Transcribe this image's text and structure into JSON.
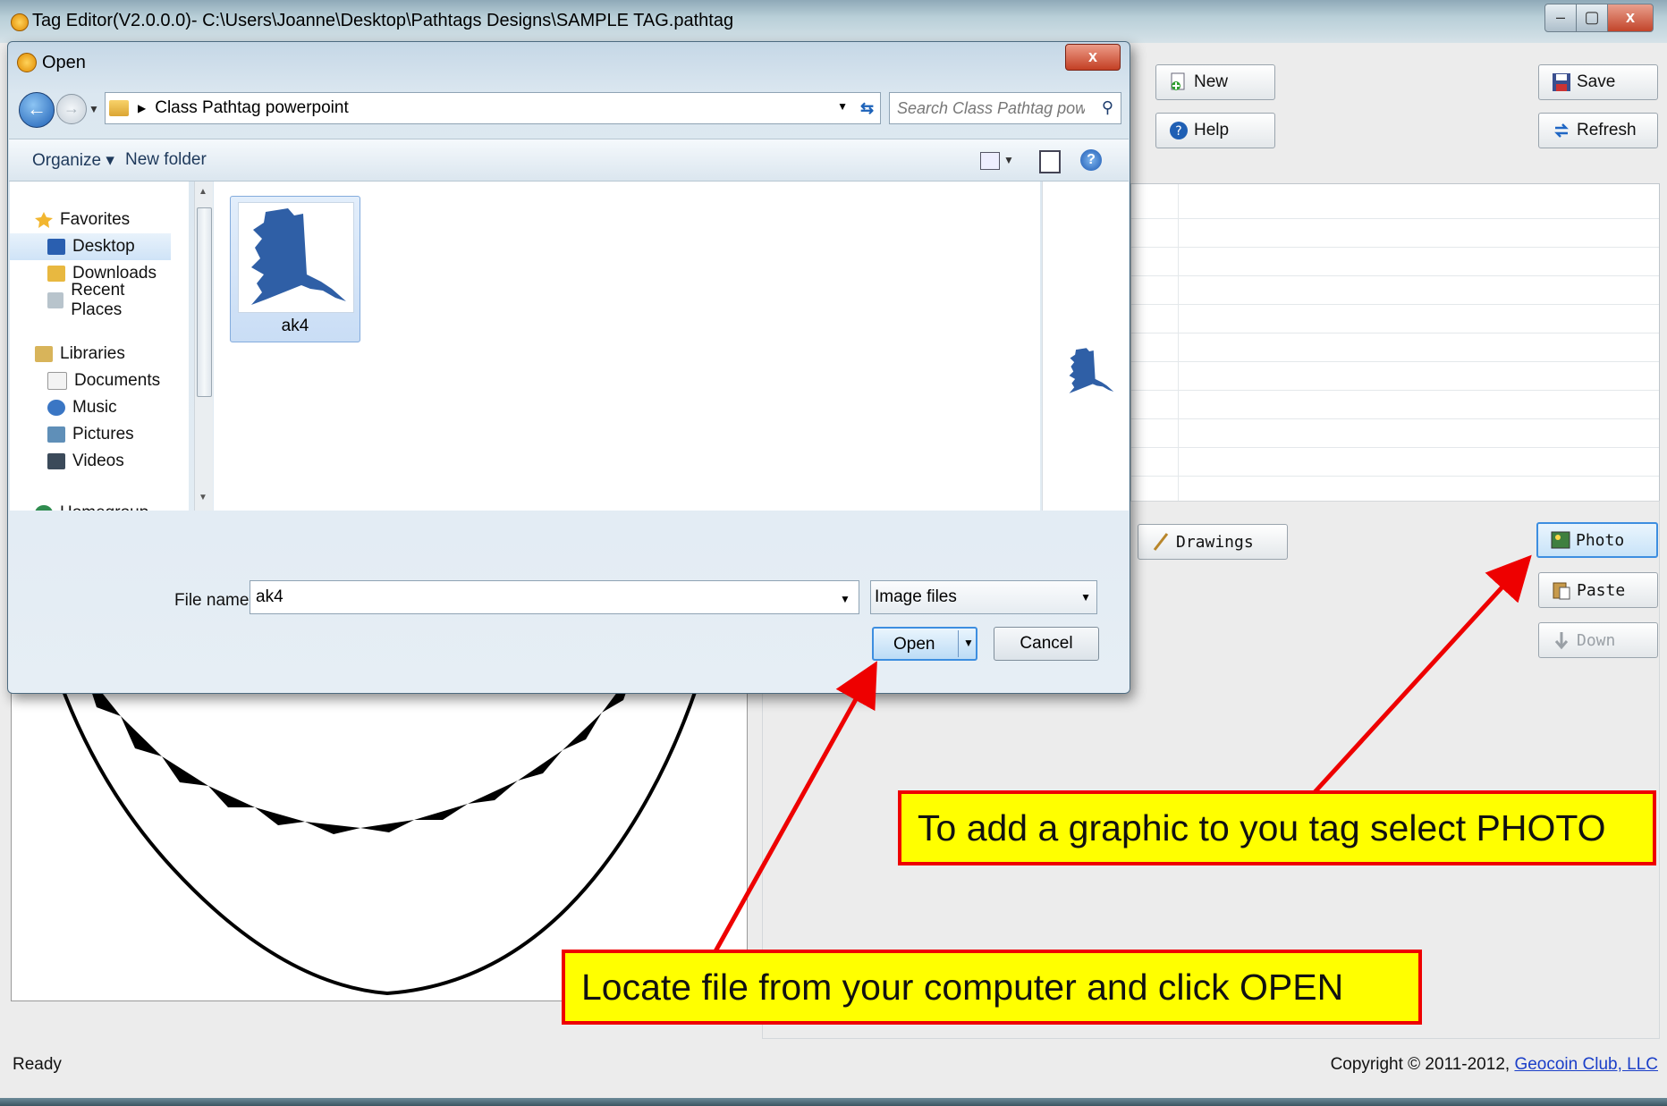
{
  "main_window": {
    "title": "Tag Editor(V2.0.0.0)- C:\\Users\\Joanne\\Desktop\\Pathtags Designs\\SAMPLE TAG.pathtag",
    "controls": {
      "minimize": "–",
      "maximize": "▢",
      "close": "x"
    },
    "toolbar": {
      "new": "New",
      "help": "Help",
      "save": "Save",
      "refresh": "Refresh"
    },
    "side_buttons": {
      "drawings": "Drawings",
      "photo": "Photo",
      "paste": "Paste",
      "down": "Down"
    },
    "status": "Ready",
    "copyright": {
      "text": "Copyright © 2011-2012, ",
      "link": "Geocoin Club, LLC"
    }
  },
  "open_dialog": {
    "title": "Open",
    "close": "x",
    "address": {
      "path": "Class Pathtag powerpoint"
    },
    "search": {
      "placeholder": "Search Class Pathtag powerpo..."
    },
    "commands": {
      "organize": "Organize ▾",
      "new_folder": "New folder"
    },
    "nav": {
      "favorites": "Favorites",
      "favorites_items": [
        "Desktop",
        "Downloads",
        "Recent Places"
      ],
      "libraries": "Libraries",
      "libraries_items": [
        "Documents",
        "Music",
        "Pictures",
        "Videos"
      ],
      "homegroup": "Homegroup"
    },
    "file": {
      "name": "ak4"
    },
    "file_name_label": "File name:",
    "file_name_value": "ak4",
    "filter": "Image files",
    "open_label": "Open",
    "cancel_label": "Cancel"
  },
  "annotations": {
    "photo": "To add a graphic to you tag select PHOTO",
    "open": "Locate file from your computer and click OPEN",
    "color_box": "#ffff00",
    "color_border": "#ee0000"
  },
  "icons": [
    "new-icon",
    "help-icon",
    "save-icon",
    "refresh-icon",
    "pencil-icon",
    "photo-icon",
    "paste-icon",
    "down-arrow-icon",
    "star-icon",
    "folder-icon",
    "alaska-icon"
  ]
}
